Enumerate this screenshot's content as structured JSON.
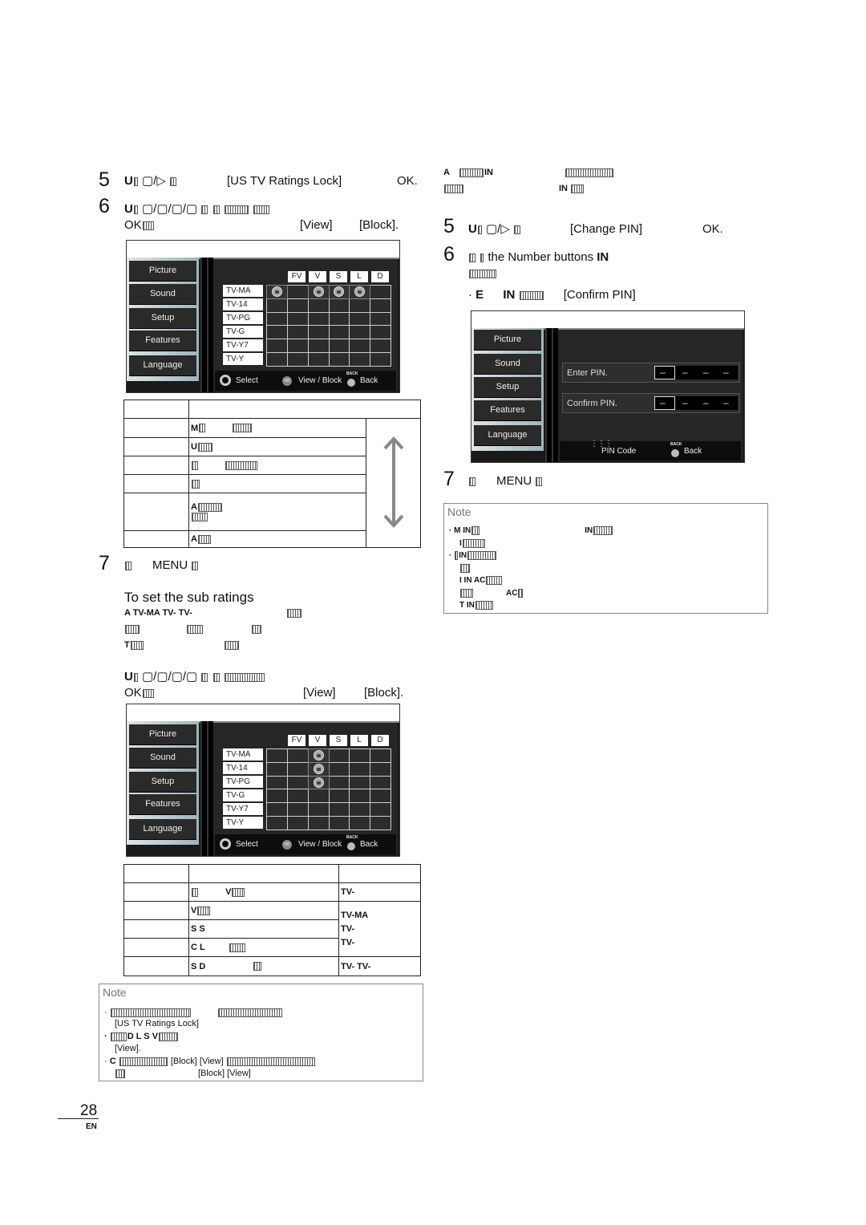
{
  "left": {
    "step5": {
      "num": "5",
      "u": "U",
      "target": "[US TV Ratings Lock]",
      "ok": "OK."
    },
    "step6": {
      "num": "6",
      "u": "U",
      "ok": "OK",
      "view": "[View]",
      "block": "[Block]."
    },
    "screen1": {
      "menu": [
        "Picture",
        "Sound",
        "Setup",
        "Features",
        "Language"
      ],
      "columns": [
        "",
        "FV",
        "V",
        "S",
        "L",
        "D"
      ],
      "rows": [
        "TV-MA",
        "TV-14",
        "TV-PG",
        "TV-G",
        "TV-Y7",
        "TV-Y"
      ],
      "locked": [
        [
          0,
          0
        ],
        [
          0,
          2
        ],
        [
          0,
          3
        ],
        [
          0,
          4
        ]
      ],
      "footer": {
        "select": "Select",
        "ok_icon": "OK",
        "view_block": "View / Block",
        "back_icon": "BACK",
        "back": "Back"
      }
    },
    "table1_rows": [
      "M",
      "U",
      "",
      "",
      "A",
      "A"
    ],
    "step7": {
      "num": "7",
      "menu": "MENU"
    },
    "subratings": {
      "title": "To set the sub ratings",
      "line1": "A TV-MA TV- TV-",
      "line3": "T"
    },
    "substep": {
      "u": "U",
      "ok": "OK",
      "view": "[View]",
      "block": "[Block]."
    },
    "screen2": {
      "locked": [
        [
          0,
          2
        ],
        [
          1,
          2
        ],
        [
          2,
          2
        ]
      ]
    },
    "table2": {
      "rows": [
        {
          "desc": "V",
          "ratings": "TV-"
        },
        {
          "desc": "V",
          "ratings": "TV-MA"
        },
        {
          "desc": "S S",
          "ratings": "TV-"
        },
        {
          "desc": "C L",
          "ratings": "TV-"
        },
        {
          "desc": "S D",
          "ratings": "TV- TV-"
        }
      ]
    },
    "note": {
      "heading": "Note",
      "lock_ref": "[US TV Ratings Lock]",
      "line3": "D L S V",
      "view1": "[View].",
      "c": "C",
      "block": "[Block]",
      "view": "[View]"
    }
  },
  "right": {
    "intro": {
      "a": "A",
      "pin": "IN",
      "pin2": "IN"
    },
    "step5": {
      "num": "5",
      "u": "U",
      "target": "[Change PIN]",
      "ok": "OK."
    },
    "step6": {
      "num": "6",
      "text": "the Number buttons",
      "pin": "IN",
      "e": "E",
      "pin2": "IN",
      "confirm": "[Confirm PIN]"
    },
    "screen3": {
      "enter_label": "Enter PIN.",
      "confirm_label": "Confirm PIN.",
      "pin_placeholder": "–",
      "footer": {
        "pin_code": "PIN Code",
        "back_icon": "BACK",
        "back": "Back"
      }
    },
    "step7": {
      "num": "7",
      "menu": "MENU"
    },
    "note": {
      "heading": "Note",
      "l1": "M IN",
      "l1b": "IN",
      "l2": "I",
      "l3": "IN",
      "l5": "I IN AC",
      "l6": "AC",
      "l7": "T IN"
    }
  },
  "page": {
    "number": "28",
    "lang": "EN"
  }
}
